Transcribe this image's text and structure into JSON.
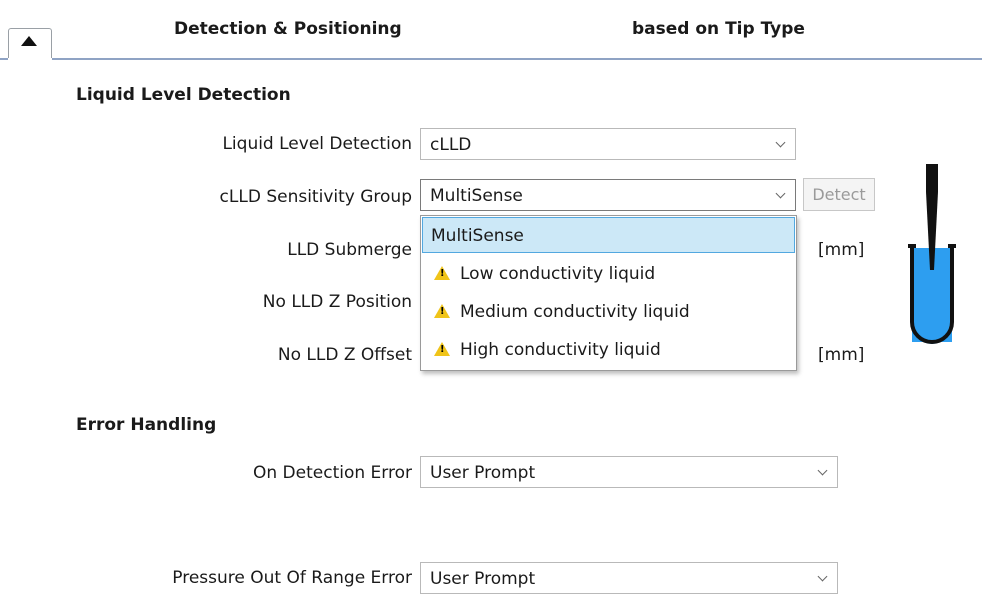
{
  "header": {
    "left_title": "Detection & Positioning",
    "right_title": "based on Tip Type"
  },
  "liquid_level": {
    "section_title": "Liquid Level Detection",
    "lld_label": "Liquid Level Detection",
    "lld_value": "cLLD",
    "sensitivity_label": "cLLD Sensitivity Group",
    "sensitivity_value": "MultiSense",
    "detect_button": "Detect",
    "submerge_label": "LLD Submerge",
    "submerge_unit": "[mm]",
    "no_lld_z_position_label": "No LLD Z Position",
    "no_lld_z_offset_label": "No LLD Z Offset",
    "no_lld_z_offset_unit": "[mm]"
  },
  "sensitivity_dropdown": {
    "options": [
      {
        "label": "MultiSense",
        "selected": true,
        "warning": false
      },
      {
        "label": "Low conductivity liquid",
        "selected": false,
        "warning": true
      },
      {
        "label": "Medium conductivity liquid",
        "selected": false,
        "warning": true
      },
      {
        "label": "High conductivity liquid",
        "selected": false,
        "warning": true
      }
    ]
  },
  "error_handling": {
    "section_title": "Error Handling",
    "detection_error_label": "On Detection Error",
    "detection_error_value": "User Prompt",
    "pressure_error_label": "Pressure Out Of Range Error",
    "pressure_error_value": "User Prompt"
  },
  "colors": {
    "liquid": "#2d9ef0",
    "tip": "#111111",
    "selected_option": "#cce8f7",
    "warning": "#f0c419"
  }
}
